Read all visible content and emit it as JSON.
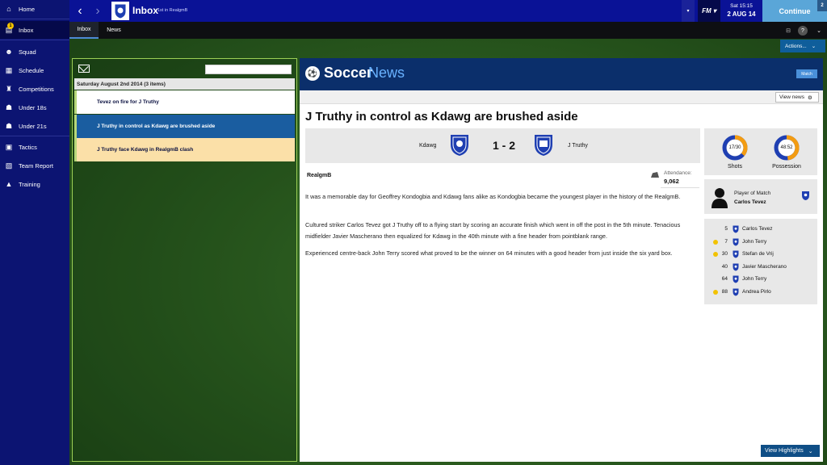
{
  "sidebar": {
    "items": [
      {
        "label": "Home",
        "icon": "home-icon"
      },
      {
        "label": "Inbox",
        "icon": "inbox-icon",
        "badge": "1"
      },
      {
        "label": "Squad",
        "icon": "squad-icon"
      },
      {
        "label": "Schedule",
        "icon": "calendar-icon"
      },
      {
        "label": "Competitions",
        "icon": "trophy-icon"
      },
      {
        "label": "Under 18s",
        "icon": "under18-icon"
      },
      {
        "label": "Under 21s",
        "icon": "under21-icon"
      },
      {
        "label": "Tactics",
        "icon": "tactics-icon"
      },
      {
        "label": "Team Report",
        "icon": "report-icon"
      },
      {
        "label": "Training",
        "icon": "training-icon"
      }
    ]
  },
  "header": {
    "title": "Inbox",
    "subtitle": "1st in RealgmB",
    "logo": "FM",
    "day_time": "Sat 15:15",
    "date": "2 AUG 14",
    "continue_label": "Continue",
    "continue_badge": "2"
  },
  "tabs": [
    {
      "label": "Inbox"
    },
    {
      "label": "News"
    }
  ],
  "actions_label": "Actions...",
  "inbox": {
    "group_header": "Saturday August 2nd 2014 (3 items)",
    "messages": [
      {
        "subject": "Tevez on fire for J Truthy"
      },
      {
        "subject": "J Truthy in control as Kdawg are brushed aside"
      },
      {
        "subject": "J Truthy face Kdawg in RealgmB clash"
      }
    ]
  },
  "article": {
    "brand_a": "Soccer",
    "brand_b": "News",
    "tag": "Match",
    "view_news_label": "View news",
    "headline": "J Truthy in control as Kdawg are brushed aside",
    "home_team": "Kdawg",
    "away_team": "J Truthy",
    "score": "1 - 2",
    "author": "RealgmB",
    "attendance_label": "Attendance:",
    "attendance": "9,062",
    "paragraphs": [
      "It was a memorable day for Geoffrey Kondogbia and Kdawg fans alike as Kondogbia became the youngest player in the history of the RealgmB.",
      "Cultured striker Carlos Tevez got J Truthy off to a flying start by scoring an accurate finish which went in off the post in the 5th minute. Tenacious midfielder Javier Mascherano then equalized for Kdawg in the 40th minute with a fine header from pointblank range.",
      "Experienced centre-back John Terry scored what proved to be the winner on 64 minutes with a good header from just inside the six yard box."
    ],
    "stats": [
      {
        "label": "Shots",
        "value_text": "17/30",
        "home": 17,
        "away": 30
      },
      {
        "label": "Possession",
        "value_text": "48:52",
        "home": 48,
        "away": 52
      }
    ],
    "potm_label": "Player of Match",
    "potm_name": "Carlos Tevez",
    "goals": [
      {
        "minute": "5",
        "player": "Carlos Tevez",
        "dot": "none"
      },
      {
        "minute": "7",
        "player": "John Terry",
        "dot": "yellow"
      },
      {
        "minute": "30",
        "player": "Stefan de Vrij",
        "dot": "yellow"
      },
      {
        "minute": "40",
        "player": "Javier Mascherano",
        "dot": "none"
      },
      {
        "minute": "64",
        "player": "John Terry",
        "dot": "none"
      },
      {
        "minute": "88",
        "player": "Andrea Pirlo",
        "dot": "yellow"
      }
    ],
    "highlights_label": "View Highlights"
  },
  "colors": {
    "sidebar": "#0c1472",
    "topbar": "#0a1296",
    "continue": "#5aa6d8",
    "panel_border": "#9ccf55",
    "selected_msg": "#1a5da0",
    "highlight_msg": "#fbe0a8",
    "donut_orange": "#f39c12",
    "donut_blue": "#1f3fb2",
    "yellow_card": "#f2c200"
  }
}
